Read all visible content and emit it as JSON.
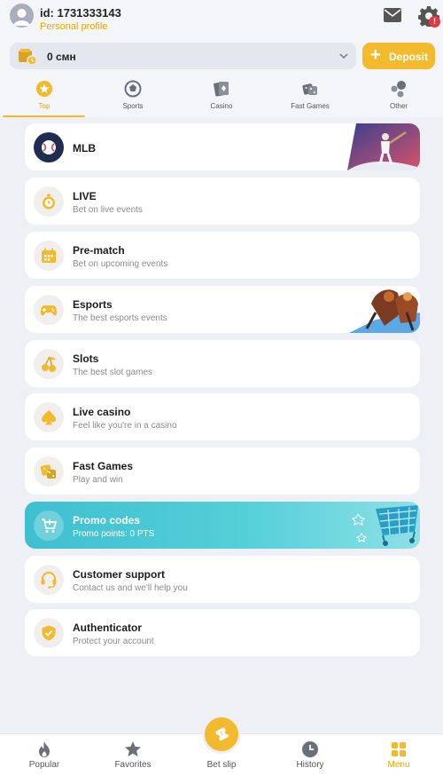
{
  "header": {
    "user_id": "id: 1731333143",
    "profile_link": "Personal profile",
    "notifications_badge": "!"
  },
  "balance": {
    "value": "0 смн",
    "deposit_label": "Deposit",
    "deposit_icon": "+"
  },
  "tabs": [
    {
      "label": "Top",
      "icon": "top-star-icon",
      "active": true
    },
    {
      "label": "Sports",
      "icon": "sports-ball-icon"
    },
    {
      "label": "Casino",
      "icon": "casino-cards-icon"
    },
    {
      "label": "Fast Games",
      "icon": "dice-icon"
    },
    {
      "label": "Other",
      "icon": "bubbles-icon"
    }
  ],
  "menu": [
    {
      "title": "MLB",
      "subtitle": "",
      "icon": "mlb-logo-icon"
    },
    {
      "title": "LIVE",
      "subtitle": "Bet on live events",
      "icon": "stopwatch-icon"
    },
    {
      "title": "Pre-match",
      "subtitle": "Bet on upcoming events",
      "icon": "calendar-icon"
    },
    {
      "title": "Esports",
      "subtitle": "The best esports events",
      "icon": "gamepad-icon"
    },
    {
      "title": "Slots",
      "subtitle": "The best slot games",
      "icon": "cherries-icon"
    },
    {
      "title": "Live casino",
      "subtitle": "Feel like you're in a casino",
      "icon": "spade-icon"
    },
    {
      "title": "Fast Games",
      "subtitle": "Play and win",
      "icon": "dice-icon"
    },
    {
      "title": "Promo codes",
      "subtitle": "Promo points: 0 PTS",
      "icon": "cart-icon"
    },
    {
      "title": "Customer support",
      "subtitle": "Contact us and we'll help you",
      "icon": "headset-icon"
    },
    {
      "title": "Authenticator",
      "subtitle": "Protect your account",
      "icon": "shield-check-icon"
    }
  ],
  "bottom_nav": [
    {
      "label": "Popular",
      "icon": "flame-icon"
    },
    {
      "label": "Favorites",
      "icon": "star-icon"
    },
    {
      "label": "Bet slip",
      "icon": "ticket-icon"
    },
    {
      "label": "History",
      "icon": "clock-icon"
    },
    {
      "label": "Menu",
      "icon": "grid-icon",
      "active": true
    }
  ],
  "colors": {
    "accent": "#f2ba2c",
    "accent_text": "#e6a700",
    "background": "#eef0f5",
    "promo": "#3fbfcf",
    "badge": "#e8383d"
  }
}
